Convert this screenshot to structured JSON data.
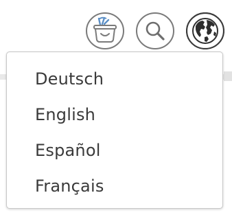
{
  "header": {
    "icons": [
      {
        "name": "shopping-basket-icon"
      },
      {
        "name": "search-icon"
      },
      {
        "name": "globe-icon"
      }
    ]
  },
  "language_menu": {
    "items": [
      {
        "label": "Deutsch"
      },
      {
        "label": "English"
      },
      {
        "label": "Español"
      },
      {
        "label": "Français"
      }
    ]
  },
  "colors": {
    "icon_stroke": "#6d6d6d",
    "basket_accent": "#5b8fc6",
    "text": "#3a3a3a",
    "border": "#c8c8c8"
  }
}
